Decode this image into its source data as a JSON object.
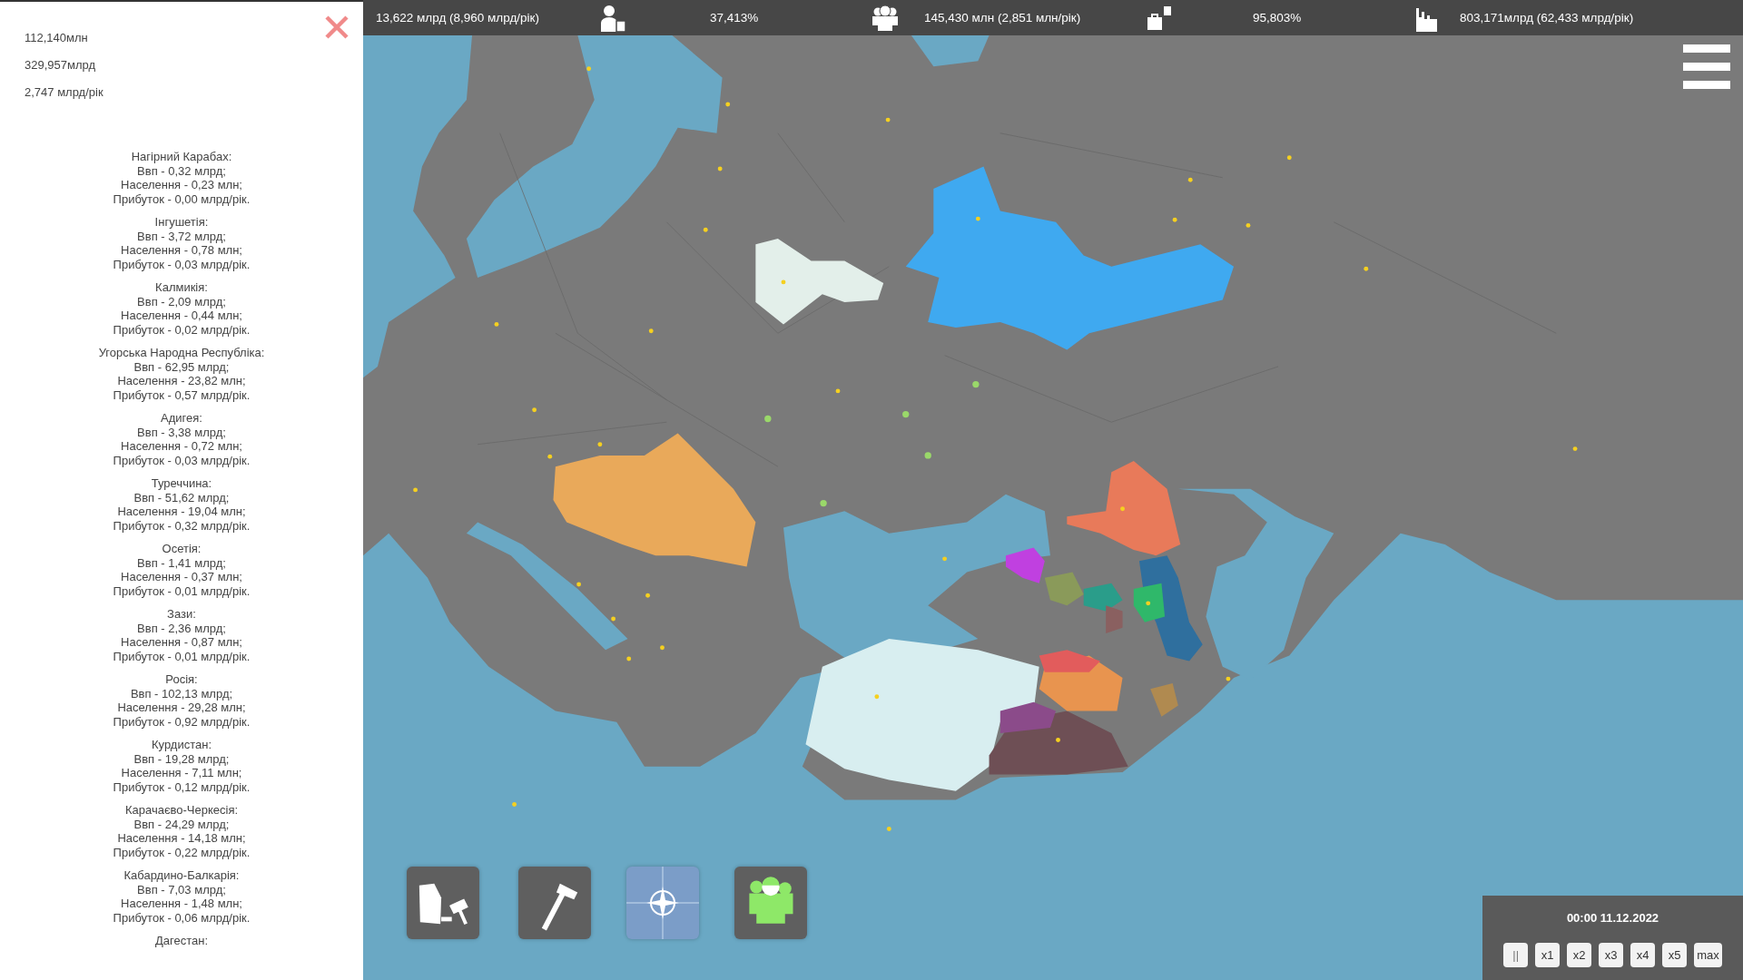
{
  "side_panel": {
    "totals": [
      "112,140млн",
      "329,957млрд",
      "2,747 млрд/рік"
    ],
    "regions": [
      {
        "name": "Нагірний Карабах:",
        "lines": [
          "Ввп - 0,32 млрд;",
          "Населення - 0,23 млн;",
          "Прибуток - 0,00 млрд/рік."
        ]
      },
      {
        "name": "Інгушетія:",
        "lines": [
          "Ввп - 3,72 млрд;",
          "Населення - 0,78 млн;",
          "Прибуток - 0,03 млрд/рік."
        ]
      },
      {
        "name": "Калмикія:",
        "lines": [
          "Ввп - 2,09 млрд;",
          "Населення - 0,44 млн;",
          "Прибуток - 0,02 млрд/рік."
        ]
      },
      {
        "name": "Угорська Народна Республіка:",
        "lines": [
          "Ввп - 62,95 млрд;",
          "Населення - 23,82 млн;",
          "Прибуток - 0,57 млрд/рік."
        ]
      },
      {
        "name": "Адигея:",
        "lines": [
          "Ввп - 3,38 млрд;",
          "Населення - 0,72 млн;",
          "Прибуток - 0,03 млрд/рік."
        ]
      },
      {
        "name": "Туреччина:",
        "lines": [
          "Ввп - 51,62 млрд;",
          "Населення - 19,04 млн;",
          "Прибуток - 0,32 млрд/рік."
        ]
      },
      {
        "name": "Осетія:",
        "lines": [
          "Ввп - 1,41 млрд;",
          "Населення - 0,37 млн;",
          "Прибуток - 0,01 млрд/рік."
        ]
      },
      {
        "name": "Зази:",
        "lines": [
          "Ввп - 2,36 млрд;",
          "Населення - 0,87 млн;",
          "Прибуток - 0,01 млрд/рік."
        ]
      },
      {
        "name": "Росія:",
        "lines": [
          "Ввп - 102,13 млрд;",
          "Населення - 29,28 млн;",
          "Прибуток - 0,92 млрд/рік."
        ]
      },
      {
        "name": "Курдистан:",
        "lines": [
          "Ввп - 19,28 млрд;",
          "Населення - 7,11 млн;",
          "Прибуток - 0,12 млрд/рік."
        ]
      },
      {
        "name": "Карачаєво-Черкесія:",
        "lines": [
          "Ввп - 24,29 млрд;",
          "Населення - 14,18 млн;",
          "Прибуток - 0,22 млрд/рік."
        ]
      },
      {
        "name": "Кабардино-Балкарія:",
        "lines": [
          "Ввп - 7,03 млрд;",
          "Населення - 1,48 млн;",
          "Прибуток - 0,06 млрд/рік."
        ]
      },
      {
        "name": "Дагестан:"
      }
    ]
  },
  "top_bar": [
    "13,622 млрд (8,960 млрд/рік)",
    "37,413%",
    "145,430 млн (2,851 млн/рік)",
    "95,803%",
    "803,171млрд (62,433 млрд/рік)"
  ],
  "clock": {
    "datetime": "00:00 11.12.2022",
    "speeds": [
      "||",
      "x1",
      "x2",
      "x3",
      "x4",
      "x5",
      "max"
    ]
  }
}
